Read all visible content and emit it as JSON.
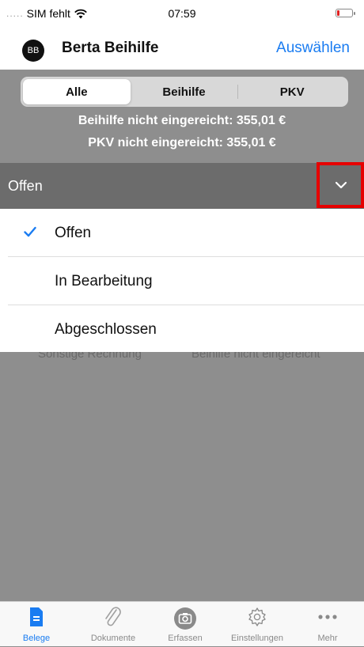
{
  "status_bar": {
    "carrier": "SIM fehlt",
    "time": "07:59"
  },
  "nav": {
    "avatar_initials": "BB",
    "title": "Berta Beihilfe",
    "action": "Auswählen"
  },
  "segments": [
    {
      "label": "Alle",
      "selected": true
    },
    {
      "label": "Beihilfe",
      "selected": false
    },
    {
      "label": "PKV",
      "selected": false
    }
  ],
  "summary": {
    "beihilfe": "Beihilfe nicht eingereicht: 355,01 €",
    "pkv": "PKV nicht eingereicht: 355,01 €"
  },
  "filter": {
    "current": "Offen"
  },
  "dropdown": {
    "options": [
      {
        "label": "Offen",
        "checked": true
      },
      {
        "label": "In Bearbeitung",
        "checked": false
      },
      {
        "label": "Abgeschlossen",
        "checked": false
      }
    ]
  },
  "background_row": {
    "type": "Sonstige Rechnung",
    "status": "Beihilfe nicht eingereicht"
  },
  "tabs": [
    {
      "label": "Belege",
      "icon": "receipt-icon",
      "active": true
    },
    {
      "label": "Dokumente",
      "icon": "paperclip-icon",
      "active": false
    },
    {
      "label": "Erfassen",
      "icon": "camera-icon",
      "active": false
    },
    {
      "label": "Einstellungen",
      "icon": "gear-icon",
      "active": false
    },
    {
      "label": "Mehr",
      "icon": "more-icon",
      "active": false
    }
  ],
  "colors": {
    "accent": "#1a7cf1",
    "highlight": "#e60000",
    "overlay": "#8e8e8e",
    "filter_bar": "#6c6c6c"
  }
}
